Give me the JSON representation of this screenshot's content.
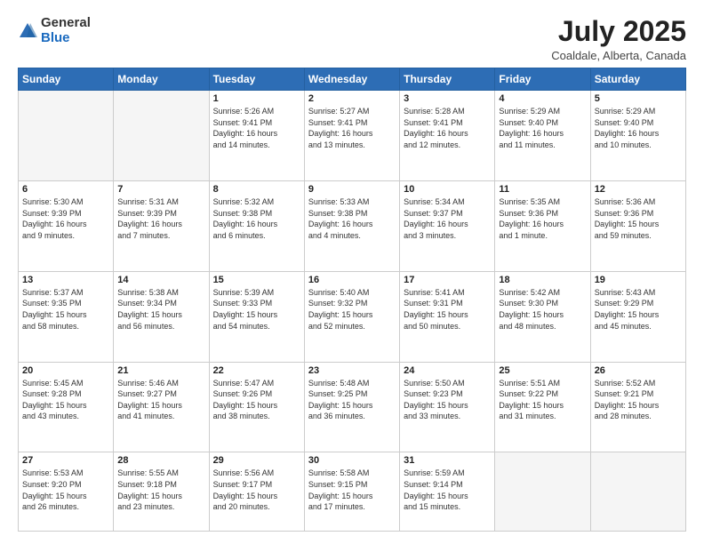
{
  "header": {
    "logo_general": "General",
    "logo_blue": "Blue",
    "month_title": "July 2025",
    "subtitle": "Coaldale, Alberta, Canada"
  },
  "days_of_week": [
    "Sunday",
    "Monday",
    "Tuesday",
    "Wednesday",
    "Thursday",
    "Friday",
    "Saturday"
  ],
  "weeks": [
    [
      {
        "day": "",
        "info": ""
      },
      {
        "day": "",
        "info": ""
      },
      {
        "day": "1",
        "info": "Sunrise: 5:26 AM\nSunset: 9:41 PM\nDaylight: 16 hours\nand 14 minutes."
      },
      {
        "day": "2",
        "info": "Sunrise: 5:27 AM\nSunset: 9:41 PM\nDaylight: 16 hours\nand 13 minutes."
      },
      {
        "day": "3",
        "info": "Sunrise: 5:28 AM\nSunset: 9:41 PM\nDaylight: 16 hours\nand 12 minutes."
      },
      {
        "day": "4",
        "info": "Sunrise: 5:29 AM\nSunset: 9:40 PM\nDaylight: 16 hours\nand 11 minutes."
      },
      {
        "day": "5",
        "info": "Sunrise: 5:29 AM\nSunset: 9:40 PM\nDaylight: 16 hours\nand 10 minutes."
      }
    ],
    [
      {
        "day": "6",
        "info": "Sunrise: 5:30 AM\nSunset: 9:39 PM\nDaylight: 16 hours\nand 9 minutes."
      },
      {
        "day": "7",
        "info": "Sunrise: 5:31 AM\nSunset: 9:39 PM\nDaylight: 16 hours\nand 7 minutes."
      },
      {
        "day": "8",
        "info": "Sunrise: 5:32 AM\nSunset: 9:38 PM\nDaylight: 16 hours\nand 6 minutes."
      },
      {
        "day": "9",
        "info": "Sunrise: 5:33 AM\nSunset: 9:38 PM\nDaylight: 16 hours\nand 4 minutes."
      },
      {
        "day": "10",
        "info": "Sunrise: 5:34 AM\nSunset: 9:37 PM\nDaylight: 16 hours\nand 3 minutes."
      },
      {
        "day": "11",
        "info": "Sunrise: 5:35 AM\nSunset: 9:36 PM\nDaylight: 16 hours\nand 1 minute."
      },
      {
        "day": "12",
        "info": "Sunrise: 5:36 AM\nSunset: 9:36 PM\nDaylight: 15 hours\nand 59 minutes."
      }
    ],
    [
      {
        "day": "13",
        "info": "Sunrise: 5:37 AM\nSunset: 9:35 PM\nDaylight: 15 hours\nand 58 minutes."
      },
      {
        "day": "14",
        "info": "Sunrise: 5:38 AM\nSunset: 9:34 PM\nDaylight: 15 hours\nand 56 minutes."
      },
      {
        "day": "15",
        "info": "Sunrise: 5:39 AM\nSunset: 9:33 PM\nDaylight: 15 hours\nand 54 minutes."
      },
      {
        "day": "16",
        "info": "Sunrise: 5:40 AM\nSunset: 9:32 PM\nDaylight: 15 hours\nand 52 minutes."
      },
      {
        "day": "17",
        "info": "Sunrise: 5:41 AM\nSunset: 9:31 PM\nDaylight: 15 hours\nand 50 minutes."
      },
      {
        "day": "18",
        "info": "Sunrise: 5:42 AM\nSunset: 9:30 PM\nDaylight: 15 hours\nand 48 minutes."
      },
      {
        "day": "19",
        "info": "Sunrise: 5:43 AM\nSunset: 9:29 PM\nDaylight: 15 hours\nand 45 minutes."
      }
    ],
    [
      {
        "day": "20",
        "info": "Sunrise: 5:45 AM\nSunset: 9:28 PM\nDaylight: 15 hours\nand 43 minutes."
      },
      {
        "day": "21",
        "info": "Sunrise: 5:46 AM\nSunset: 9:27 PM\nDaylight: 15 hours\nand 41 minutes."
      },
      {
        "day": "22",
        "info": "Sunrise: 5:47 AM\nSunset: 9:26 PM\nDaylight: 15 hours\nand 38 minutes."
      },
      {
        "day": "23",
        "info": "Sunrise: 5:48 AM\nSunset: 9:25 PM\nDaylight: 15 hours\nand 36 minutes."
      },
      {
        "day": "24",
        "info": "Sunrise: 5:50 AM\nSunset: 9:23 PM\nDaylight: 15 hours\nand 33 minutes."
      },
      {
        "day": "25",
        "info": "Sunrise: 5:51 AM\nSunset: 9:22 PM\nDaylight: 15 hours\nand 31 minutes."
      },
      {
        "day": "26",
        "info": "Sunrise: 5:52 AM\nSunset: 9:21 PM\nDaylight: 15 hours\nand 28 minutes."
      }
    ],
    [
      {
        "day": "27",
        "info": "Sunrise: 5:53 AM\nSunset: 9:20 PM\nDaylight: 15 hours\nand 26 minutes."
      },
      {
        "day": "28",
        "info": "Sunrise: 5:55 AM\nSunset: 9:18 PM\nDaylight: 15 hours\nand 23 minutes."
      },
      {
        "day": "29",
        "info": "Sunrise: 5:56 AM\nSunset: 9:17 PM\nDaylight: 15 hours\nand 20 minutes."
      },
      {
        "day": "30",
        "info": "Sunrise: 5:58 AM\nSunset: 9:15 PM\nDaylight: 15 hours\nand 17 minutes."
      },
      {
        "day": "31",
        "info": "Sunrise: 5:59 AM\nSunset: 9:14 PM\nDaylight: 15 hours\nand 15 minutes."
      },
      {
        "day": "",
        "info": ""
      },
      {
        "day": "",
        "info": ""
      }
    ]
  ]
}
